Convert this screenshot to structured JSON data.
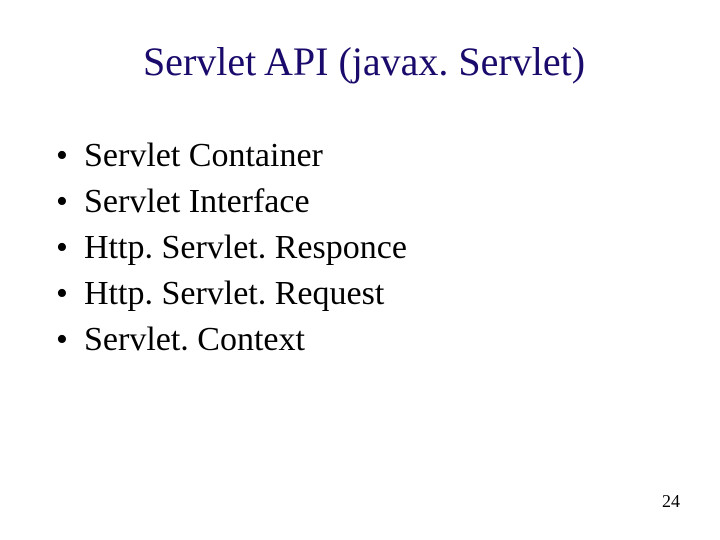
{
  "title": "Servlet API (javax. Servlet)",
  "bullets": [
    "Servlet Container",
    "Servlet Interface",
    "Http. Servlet. Responce",
    "Http. Servlet. Request",
    "Servlet. Context"
  ],
  "page_number": "24"
}
